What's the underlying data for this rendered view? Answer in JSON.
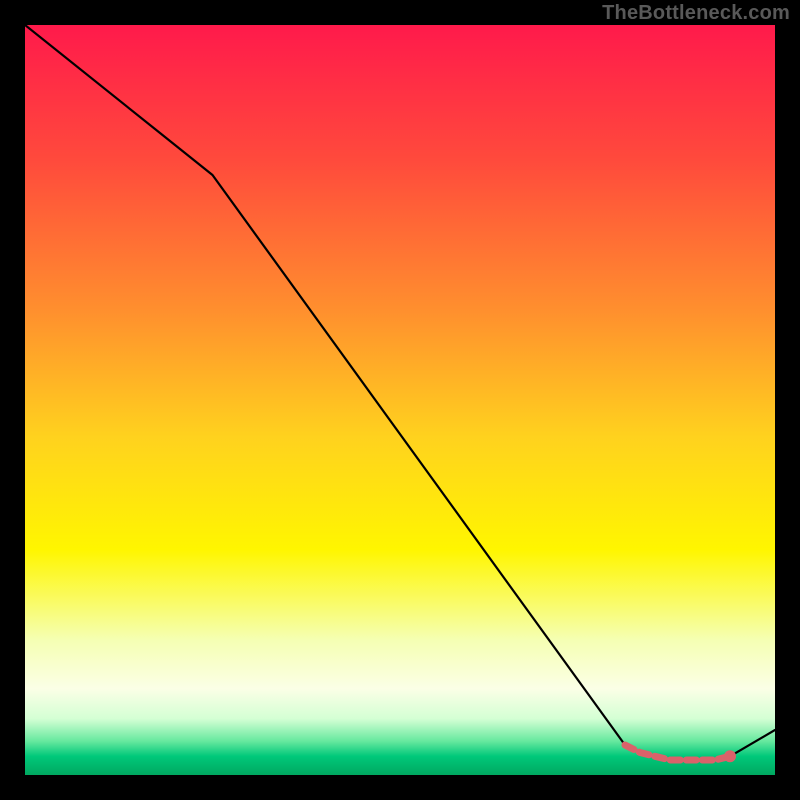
{
  "watermark": "TheBottleneck.com",
  "chart_data": {
    "type": "line",
    "title": "",
    "xlabel": "",
    "ylabel": "",
    "xlim": [
      0,
      100
    ],
    "ylim": [
      0,
      100
    ],
    "series": [
      {
        "name": "main-curve",
        "x": [
          0,
          25,
          80,
          82,
          84,
          86,
          88,
          90,
          92,
          94,
          100
        ],
        "y": [
          100,
          80,
          4,
          3,
          2.5,
          2,
          2,
          2,
          2,
          2.5,
          6
        ]
      }
    ],
    "highlight_segment": {
      "name": "valley-highlight",
      "color": "#d9626a",
      "x": [
        80,
        82,
        84,
        86,
        88,
        90,
        92,
        94
      ],
      "y": [
        4,
        3,
        2.5,
        2,
        2,
        2,
        2,
        2.5
      ]
    },
    "highlight_dot": {
      "x": 94,
      "y": 2.5,
      "color": "#d9626a"
    },
    "gradient_stops": [
      {
        "offset": 0.0,
        "color": "#ff1a4b"
      },
      {
        "offset": 0.18,
        "color": "#ff4a3c"
      },
      {
        "offset": 0.38,
        "color": "#ff8f2e"
      },
      {
        "offset": 0.55,
        "color": "#ffd21e"
      },
      {
        "offset": 0.7,
        "color": "#fff600"
      },
      {
        "offset": 0.82,
        "color": "#f5ffb3"
      },
      {
        "offset": 0.885,
        "color": "#fbffe6"
      },
      {
        "offset": 0.925,
        "color": "#d4ffd4"
      },
      {
        "offset": 0.955,
        "color": "#66e89e"
      },
      {
        "offset": 0.975,
        "color": "#00c87a"
      },
      {
        "offset": 1.0,
        "color": "#00a860"
      }
    ]
  }
}
